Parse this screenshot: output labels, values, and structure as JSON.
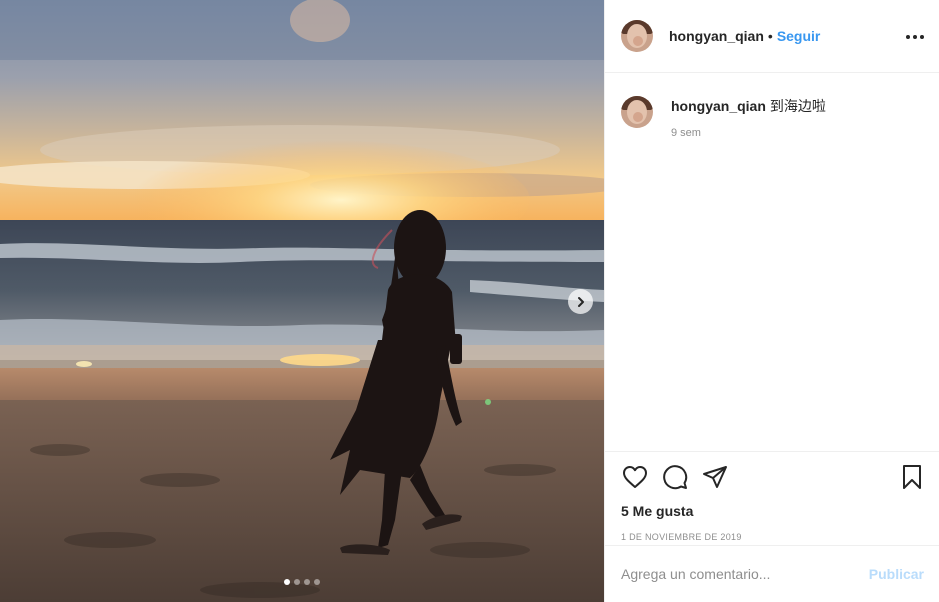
{
  "post": {
    "username": "hongyan_qian",
    "separator": "•",
    "follow_label": "Seguir",
    "caption_text": "到海边啦",
    "caption_time": "9 sem",
    "likes_text": "5 Me gusta",
    "date_text": "1 DE NOVIEMBRE DE 2019",
    "carousel_count": 4,
    "carousel_active_index": 0
  },
  "comment": {
    "placeholder": "Agrega un comentario...",
    "publish_label": "Publicar"
  },
  "icons": {
    "options": "more-horizontal-icon",
    "next": "chevron-right-icon",
    "like": "heart-icon",
    "comment": "comment-bubble-icon",
    "share": "paper-plane-icon",
    "save": "bookmark-icon"
  },
  "colors": {
    "accent": "#3897f0",
    "publish_disabled": "#b9dcfb",
    "muted_text": "#8e8e8e",
    "divider": "#efefef"
  }
}
